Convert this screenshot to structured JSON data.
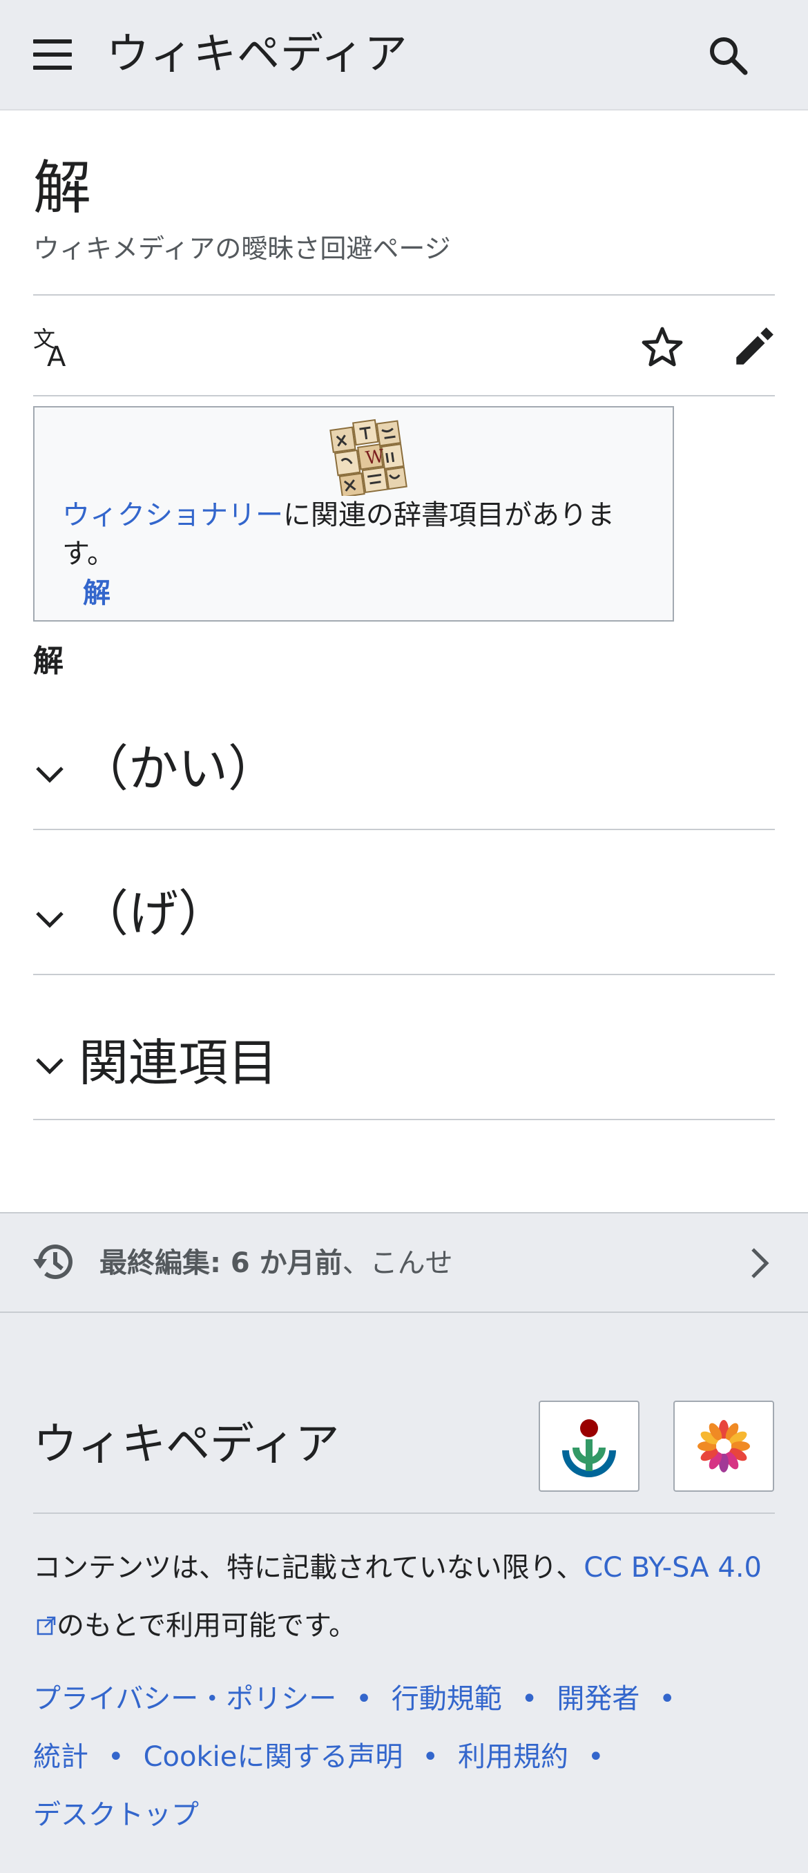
{
  "header": {
    "brand": "ウィキペディア",
    "menu_icon": "hamburger-menu-icon",
    "search_icon": "search-icon"
  },
  "page": {
    "title": "解",
    "subtitle": "ウィキメディアの曖昧さ回避ページ"
  },
  "actions": {
    "language_icon": "translate-icon",
    "watch_icon": "star-icon",
    "edit_icon": "pencil-icon"
  },
  "wiktionary_box": {
    "link_text": "ウィクショナリー",
    "text": "に関連の辞書項目があります。",
    "term": "解"
  },
  "content": {
    "bold_heading": "解",
    "sections": [
      {
        "title": "（かい）"
      },
      {
        "title": "（げ）"
      },
      {
        "title": "関連項目"
      }
    ]
  },
  "last_edited": {
    "label": "最終編集: 6 か月前",
    "separator": "、",
    "user": "こんせ"
  },
  "footer": {
    "brand": "ウィキペディア",
    "license_before": "コンテンツは、特に記載されていない限り、",
    "license_link": "CC BY-SA 4.0",
    "license_after": "のもとで利用可能です。",
    "links": [
      "プライバシー・ポリシー",
      "行動規範",
      "開発者",
      "統計",
      "Cookieに関する声明",
      "利用規約",
      "デスクトップ"
    ]
  },
  "colors": {
    "link": "#3366cc",
    "header_bg": "#eaecf0",
    "text": "#202122",
    "secondary_text": "#54595d"
  }
}
